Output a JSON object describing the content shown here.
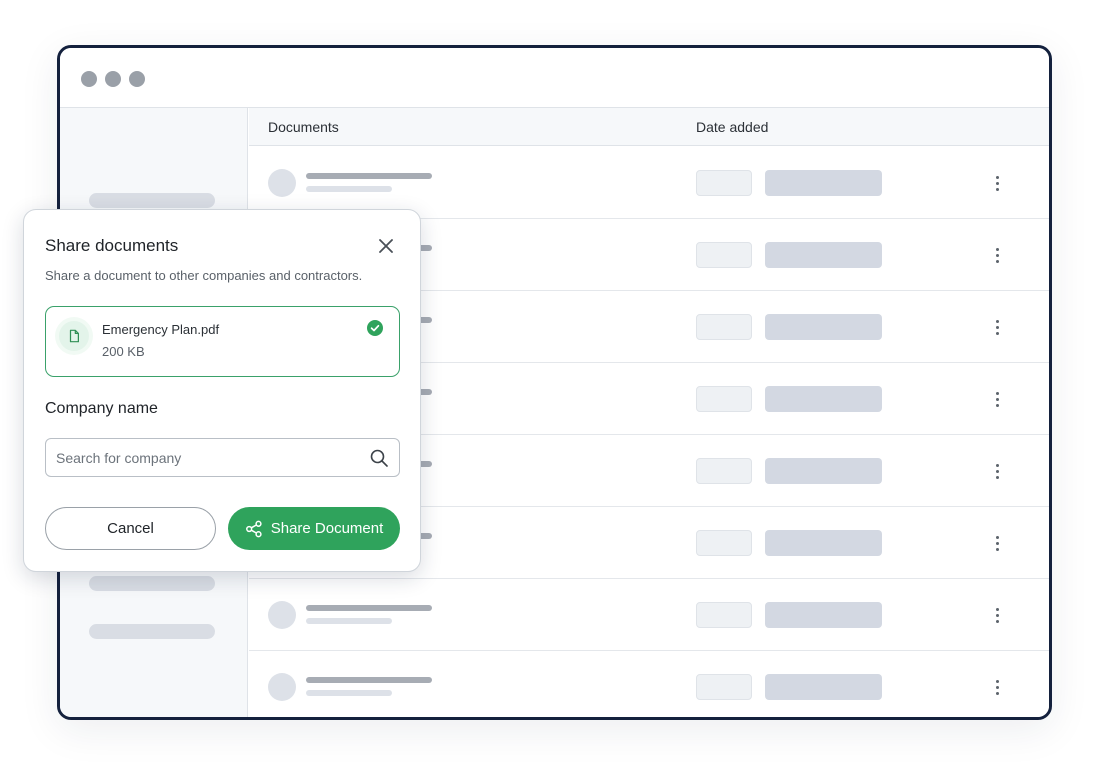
{
  "table": {
    "col_documents": "Documents",
    "col_date_added": "Date added",
    "row_count": 8
  },
  "modal": {
    "title": "Share documents",
    "subtitle": "Share a document to other companies and contractors.",
    "file": {
      "name": "Emergency Plan.pdf",
      "size": "200 KB",
      "icon": "document-icon",
      "status_icon": "check-circle-icon"
    },
    "company_label": "Company name",
    "search_placeholder": "Search for company",
    "cancel_label": "Cancel",
    "share_label": "Share Document",
    "share_icon": "share-icon",
    "close_icon": "close-icon"
  },
  "colors": {
    "accent": "#2fa35c",
    "frame": "#14213d"
  }
}
